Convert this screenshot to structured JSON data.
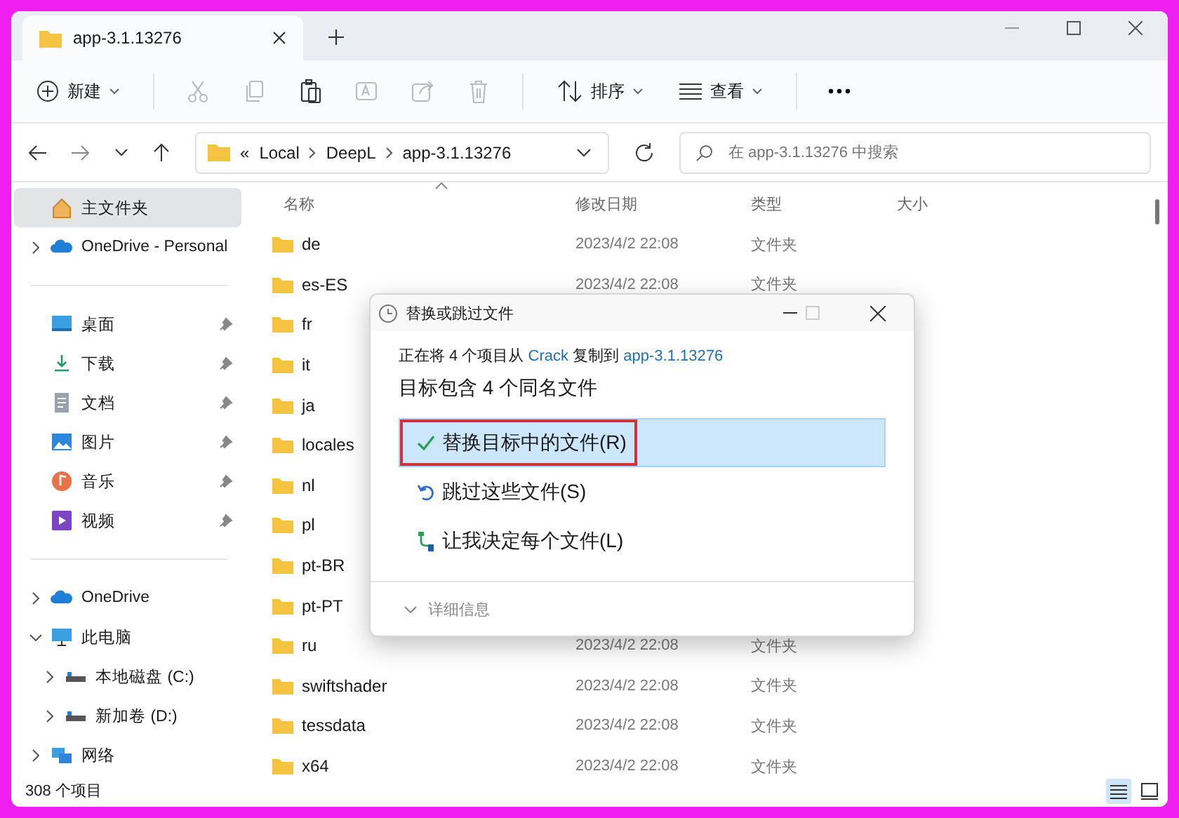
{
  "tab": {
    "title": "app-3.1.13276"
  },
  "toolbar": {
    "new": {
      "label": "新建"
    },
    "tools": [
      {
        "kind": "cut",
        "disabled": true
      },
      {
        "kind": "copy",
        "disabled": true
      },
      {
        "kind": "paste",
        "disabled": false
      },
      {
        "kind": "rename",
        "disabled": true
      },
      {
        "kind": "share",
        "disabled": true
      },
      {
        "kind": "delete",
        "disabled": true
      }
    ],
    "sort": {
      "label": "排序"
    },
    "view": {
      "label": "查看"
    }
  },
  "address": {
    "overflow": "«",
    "crumbs": [
      "Local",
      "DeepL",
      "app-3.1.13276"
    ]
  },
  "search": {
    "placeholder": "在 app-3.1.13276 中搜索"
  },
  "sidebar": {
    "sections": [
      {
        "items": [
          {
            "label": "主文件夹",
            "selected": true
          },
          {
            "label": "OneDrive - Personal",
            "selected": false,
            "expanded": false
          }
        ]
      },
      {
        "items": [
          {
            "label": "桌面",
            "selected": false,
            "pinned": true
          },
          {
            "label": "下载",
            "selected": false,
            "pinned": true
          },
          {
            "label": "文档",
            "selected": false,
            "pinned": true
          },
          {
            "label": "图片",
            "selected": false,
            "pinned": true
          },
          {
            "label": "音乐",
            "selected": false,
            "pinned": true
          },
          {
            "label": "视频",
            "selected": false,
            "pinned": true
          }
        ]
      },
      {
        "items": [
          {
            "label": "OneDrive",
            "selected": false,
            "expanded": false
          },
          {
            "label": "此电脑",
            "selected": false,
            "expanded": true,
            "children": [
              {
                "label": "本地磁盘 (C:)",
                "selected": false,
                "expanded": false
              },
              {
                "label": "新加卷 (D:)",
                "selected": false,
                "expanded": false
              }
            ]
          },
          {
            "label": "网络",
            "selected": false,
            "expanded": false
          }
        ]
      }
    ]
  },
  "table": {
    "columns": [
      "名称",
      "修改日期",
      "类型",
      "大小"
    ],
    "rows": [
      {
        "name": "de",
        "date": "2023/4/2 22:08",
        "type": "文件夹"
      },
      {
        "name": "es-ES",
        "date": "2023/4/2 22:08",
        "type": "文件夹"
      },
      {
        "name": "fr"
      },
      {
        "name": "it"
      },
      {
        "name": "ja"
      },
      {
        "name": "locales"
      },
      {
        "name": "nl"
      },
      {
        "name": "pl"
      },
      {
        "name": "pt-BR"
      },
      {
        "name": "pt-PT"
      },
      {
        "name": "ru",
        "date": "2023/4/2 22:08",
        "type": "文件夹"
      },
      {
        "name": "swiftshader",
        "date": "2023/4/2 22:08",
        "type": "文件夹"
      },
      {
        "name": "tessdata",
        "date": "2023/4/2 22:08",
        "type": "文件夹"
      },
      {
        "name": "x64",
        "date": "2023/4/2 22:08",
        "type": "文件夹"
      }
    ]
  },
  "status_bar": {
    "count": "308 个项目",
    "views": [
      {
        "kind": "details",
        "selected": true
      },
      {
        "kind": "tiles",
        "selected": false
      }
    ]
  },
  "dialog": {
    "title": "替换或跳过文件",
    "message": {
      "prefix": "正在将 4 个项目从 ",
      "source": "Crack",
      "middle": " 复制到 ",
      "target": "app-3.1.13276"
    },
    "heading": "目标包含 4 个同名文件",
    "options": [
      {
        "kind": "replace",
        "label": "替换目标中的文件(R)",
        "selected": true,
        "annotated": true
      },
      {
        "kind": "skip",
        "label": "跳过这些文件(S)",
        "selected": false,
        "annotated": false
      },
      {
        "kind": "decide",
        "label": "让我决定每个文件(L)",
        "selected": false,
        "annotated": false
      }
    ],
    "details": {
      "label": "详细信息",
      "expanded": false
    }
  }
}
